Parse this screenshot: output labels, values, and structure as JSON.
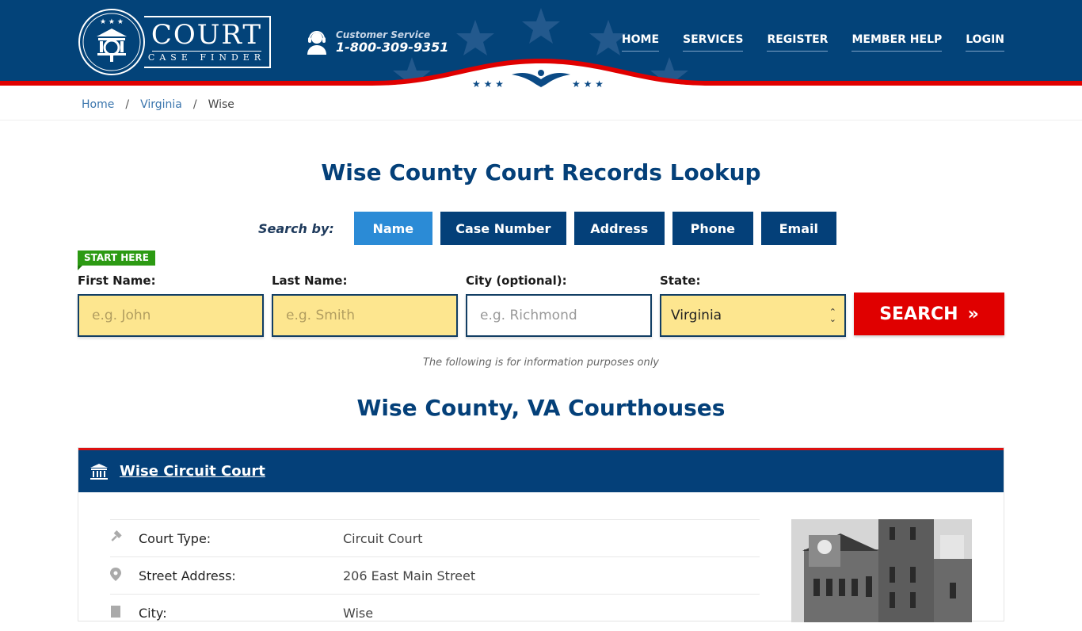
{
  "header": {
    "logo": {
      "title": "COURT",
      "subtitle": "CASE FINDER"
    },
    "customer_service": {
      "label": "Customer Service",
      "phone": "1-800-309-9351",
      "icon": "headset-icon"
    },
    "nav": [
      {
        "label": "HOME"
      },
      {
        "label": "SERVICES"
      },
      {
        "label": "REGISTER"
      },
      {
        "label": "MEMBER HELP"
      },
      {
        "label": "LOGIN"
      }
    ],
    "colors": {
      "navy": "#034379",
      "red": "#e00000"
    }
  },
  "breadcrumb": [
    {
      "label": "Home"
    },
    {
      "label": "Virginia"
    },
    {
      "label": "Wise"
    }
  ],
  "page_title": "Wise County Court Records Lookup",
  "search": {
    "search_by_label": "Search by:",
    "tabs": [
      {
        "label": "Name",
        "active": true
      },
      {
        "label": "Case Number",
        "active": false
      },
      {
        "label": "Address",
        "active": false
      },
      {
        "label": "Phone",
        "active": false
      },
      {
        "label": "Email",
        "active": false
      }
    ],
    "start_here": "START HERE",
    "fields": {
      "first_name": {
        "label": "First Name:",
        "placeholder": "e.g. John"
      },
      "last_name": {
        "label": "Last Name:",
        "placeholder": "e.g. Smith"
      },
      "city": {
        "label": "City (optional):",
        "placeholder": "e.g.  Richmond"
      },
      "state": {
        "label": "State:",
        "value": "Virginia"
      }
    },
    "submit_label": "SEARCH",
    "submit_icon": "double-chevron-right-icon"
  },
  "disclaimer": "The following is for information purposes only",
  "courthouses_title": "Wise County, VA Courthouses",
  "courts": [
    {
      "name": "Wise Circuit Court",
      "icon": "courthouse-icon",
      "details": [
        {
          "icon": "gavel-icon",
          "label": "Court Type:",
          "value": "Circuit Court"
        },
        {
          "icon": "map-pin-icon",
          "label": "Street Address:",
          "value": "206 East Main Street"
        },
        {
          "icon": "building-icon",
          "label": "City:",
          "value": "Wise"
        }
      ]
    }
  ]
}
